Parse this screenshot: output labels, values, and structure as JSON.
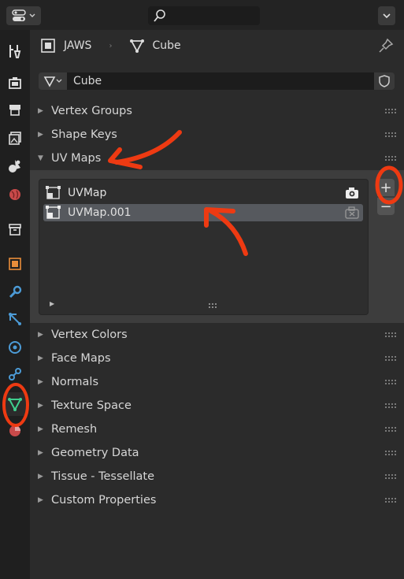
{
  "header": {
    "editor_type_icon": "properties-editor-icon",
    "search_icon": "search-icon",
    "menu_icon": "chevron-down-icon"
  },
  "breadcrumb": {
    "object": "JAWS",
    "mesh": "Cube"
  },
  "datablock": {
    "name": "Cube"
  },
  "panels_top": [
    {
      "label": "Vertex Groups",
      "expanded": false
    },
    {
      "label": "Shape Keys",
      "expanded": false
    },
    {
      "label": "UV Maps",
      "expanded": true
    }
  ],
  "uv_maps": {
    "items": [
      {
        "name": "UVMap",
        "active_render": true,
        "selected": false
      },
      {
        "name": "UVMap.001",
        "active_render": false,
        "selected": true
      }
    ],
    "add_label": "+",
    "remove_label": "−"
  },
  "panels_bottom": [
    {
      "label": "Vertex Colors"
    },
    {
      "label": "Face Maps"
    },
    {
      "label": "Normals"
    },
    {
      "label": "Texture Space"
    },
    {
      "label": "Remesh"
    },
    {
      "label": "Geometry Data"
    },
    {
      "label": "Tissue - Tessellate"
    },
    {
      "label": "Custom Properties"
    }
  ],
  "colors": {
    "annotation": "#ee3a12",
    "active_tab_green": "#3fcf8e",
    "accent_orange": "#e98d3a"
  }
}
